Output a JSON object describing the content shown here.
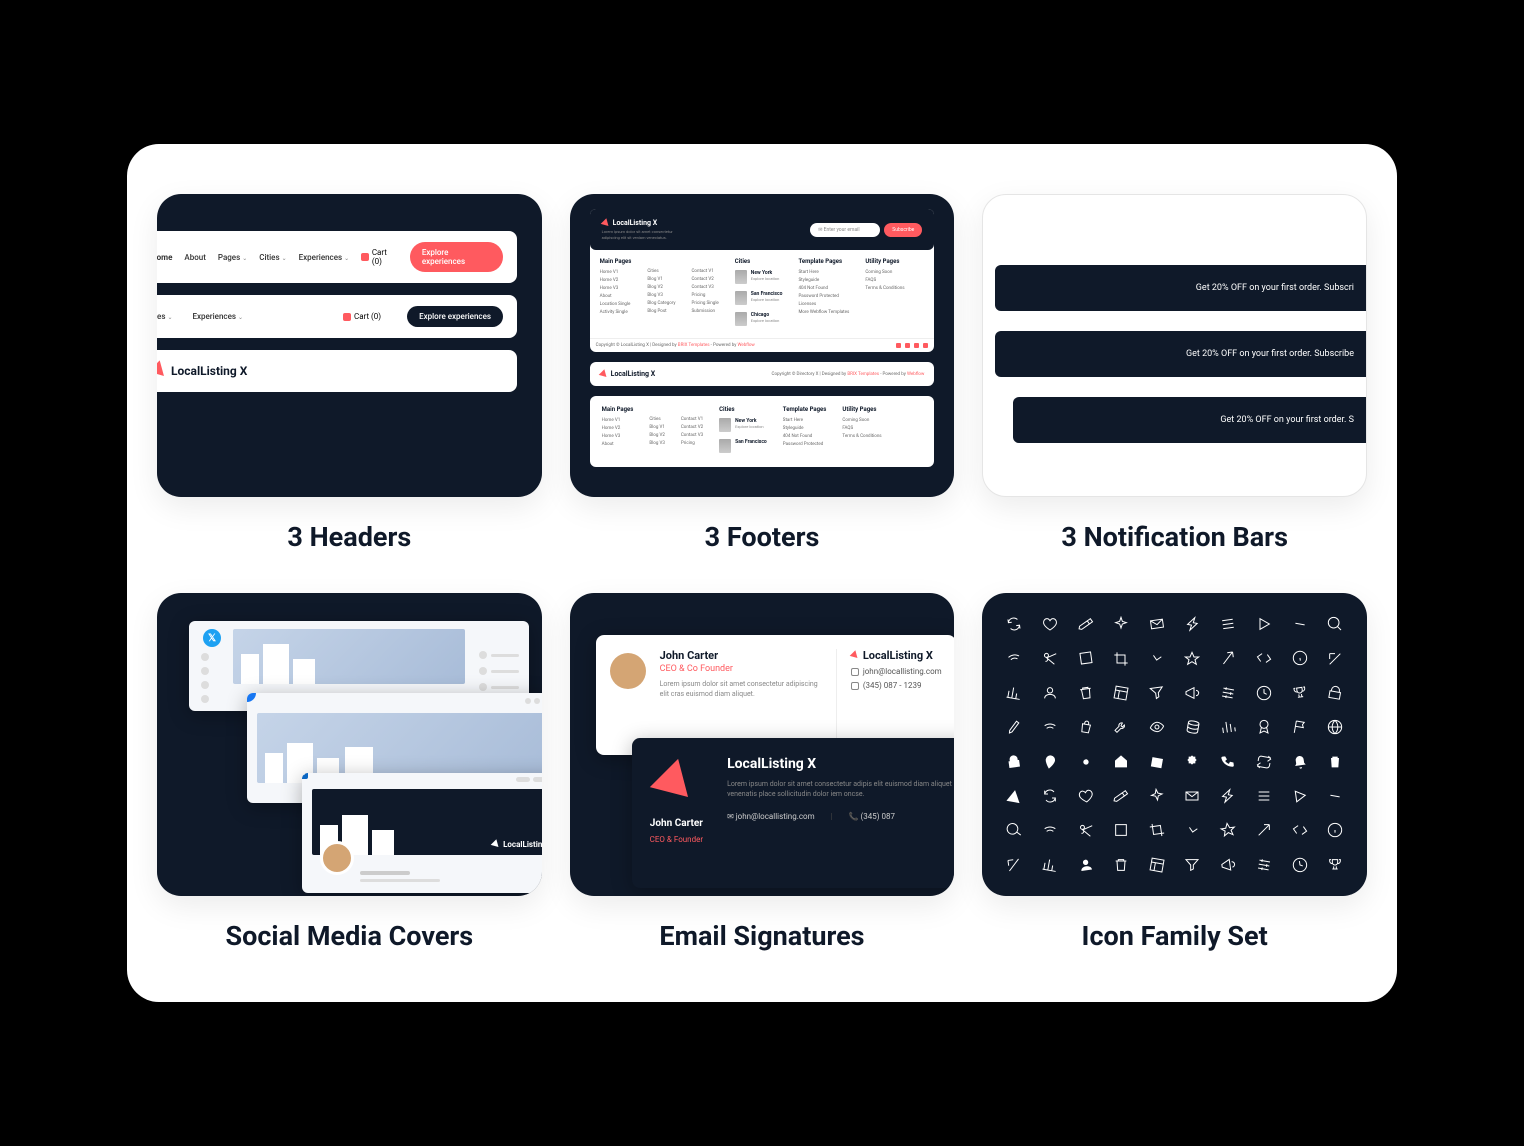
{
  "cards": {
    "headers": {
      "title": "3 Headers"
    },
    "footers": {
      "title": "3 Footers"
    },
    "notifications": {
      "title": "3 Notification Bars"
    },
    "social": {
      "title": "Social Media Covers"
    },
    "email": {
      "title": "Email Signatures"
    },
    "icons": {
      "title": "Icon Family Set"
    }
  },
  "brand": {
    "name": "LocalListing X"
  },
  "header_nav": {
    "items": [
      "Home",
      "About",
      "Pages",
      "Cities",
      "Experiences"
    ],
    "cart": "Cart (0)",
    "cta_explore": "Explore experiences"
  },
  "header2": {
    "items": [
      "ies",
      "Experiences"
    ],
    "cart": "Cart (0)",
    "cta": "Explore experiences"
  },
  "footer": {
    "desc": "Lorem ipsum dolor sit amet consectetur adipiscing elit sit veniam veneciatus.",
    "input_placeholder": "Enter your email",
    "subscribe": "Subscribe",
    "cols": {
      "main": {
        "title": "Main Pages",
        "links": [
          "Home V1",
          "Home V2",
          "Home V3",
          "About",
          "Location Single",
          "Activity Single"
        ]
      },
      "main2": {
        "links": [
          "Cities",
          "Blog V1",
          "Blog V2",
          "Blog V3",
          "Blog Category",
          "Blog Post"
        ]
      },
      "main3": {
        "links": [
          "Contact V1",
          "Contact V2",
          "Contact V3",
          "Pricing",
          "Pricing Single",
          "Submission"
        ]
      },
      "cities": {
        "title": "Cities",
        "items": [
          {
            "name": "New York",
            "desc": "Explore location"
          },
          {
            "name": "San Francisco",
            "desc": "Explore location"
          },
          {
            "name": "Chicago",
            "desc": "Explore location"
          }
        ]
      },
      "template": {
        "title": "Template Pages",
        "links": [
          "Start Here",
          "Styleguide",
          "404 Not Found",
          "Password Protected",
          "Licenses",
          "More Webflow Templates"
        ]
      },
      "utility": {
        "title": "Utility Pages",
        "links": [
          "Coming Soon",
          "FAQS",
          "Terms & Conditions"
        ]
      }
    },
    "copyright": "Copyright © LocalListing X | Designed by",
    "copyright_link": "BRIX Templates",
    "powered": "- Powered by",
    "powered_link": "Webflow",
    "copyright2": "Copyright © Directory X | Designed by"
  },
  "notifications": {
    "bar1": "Get 20% OFF on your first order. Subscri",
    "bar2": "Get 20% OFF on your first order. Subscribe",
    "bar3": "Get 20% OFF on your first order. S"
  },
  "email": {
    "person": {
      "name": "John Carter",
      "title1": "CEO & Co Founder",
      "title2": "CEO & Founder",
      "desc": "Lorem ipsum dolor sit amet consectetur adipiscing elit cras euismod diam aliquet.",
      "email": "john@locallisting.com",
      "phone": "(345) 087 - 1239",
      "phone2": "(345) 087"
    },
    "desc2": "Lorem ipsum dolor sit amet consectetur adipis elit euismod diam aliquet venenatis place sollicitudin dolor iem oncse."
  },
  "icons": [
    "refresh",
    "heart",
    "edit",
    "sparkle",
    "mail",
    "bolt",
    "lines",
    "play",
    "minus",
    "search",
    "wifi",
    "scissors",
    "box",
    "crop",
    "caret",
    "star",
    "arrow",
    "code",
    "info",
    "arrow-ul",
    "chart",
    "user",
    "trash",
    "layout",
    "funnel",
    "horn",
    "sliders",
    "clock",
    "trophy",
    "lock",
    "pencil",
    "wifi2",
    "bag",
    "wrench",
    "eye",
    "db",
    "bars",
    "badge",
    "flag",
    "globe",
    "lock2",
    "pin",
    "gear",
    "home",
    "cal",
    "seal",
    "phone",
    "repeat",
    "bell",
    "bin",
    "alert"
  ]
}
